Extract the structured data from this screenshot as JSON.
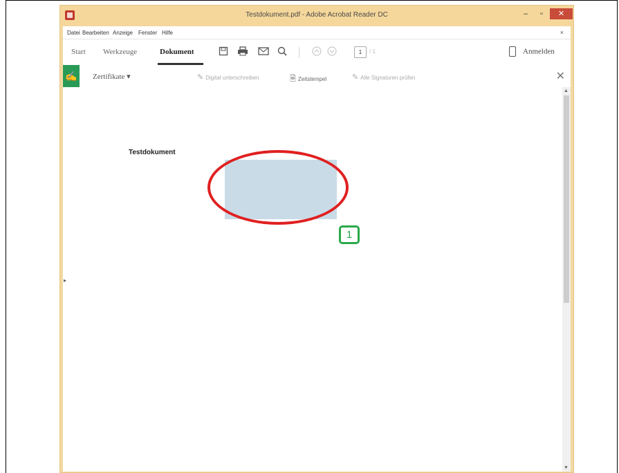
{
  "window": {
    "title": "Testdokument.pdf - Adobe Acrobat Reader DC",
    "minimize": "–",
    "maximize": "▫",
    "close": "✕"
  },
  "menubar": {
    "items": [
      "Datei",
      "Bearbeiten",
      "Anzeige",
      "Fenster",
      "Hilfe"
    ],
    "close": "×"
  },
  "toolbar": {
    "tabs": [
      "Start",
      "Werkzeuge",
      "Dokument"
    ],
    "active_tab": "Dokument",
    "page_current": "1",
    "page_total": "/ 1",
    "login": "Anmelden"
  },
  "certbar": {
    "label": "Zertifikate ▾",
    "actions": [
      "Digital unterschreiben",
      "Zeitstempel",
      "Alle Signaturen prüfen"
    ],
    "close": "✕"
  },
  "document": {
    "title": "Testdokument",
    "badge": "1"
  },
  "colors": {
    "window_frame": "#f3d9a0",
    "certificate_green": "#2a9b57",
    "signature_field": "#c9dbe7",
    "annotation_red": "#e02020",
    "badge_green": "#2aa84a"
  }
}
